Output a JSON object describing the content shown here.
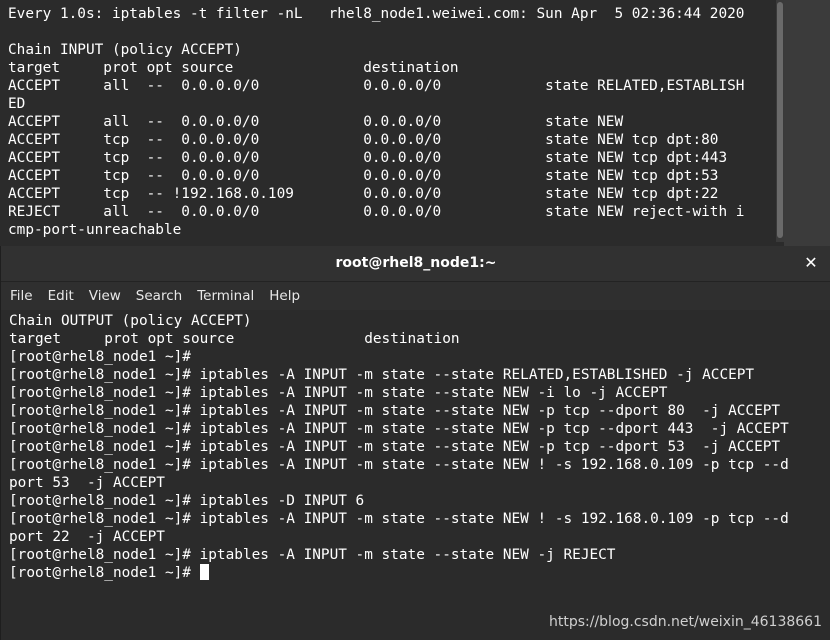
{
  "top_terminal": {
    "lines": [
      "Every 1.0s: iptables -t filter -nL   rhel8_node1.weiwei.com: Sun Apr  5 02:36:44 2020",
      "",
      "Chain INPUT (policy ACCEPT)",
      "target     prot opt source               destination",
      "ACCEPT     all  --  0.0.0.0/0            0.0.0.0/0            state RELATED,ESTABLISH",
      "ED",
      "ACCEPT     all  --  0.0.0.0/0            0.0.0.0/0            state NEW",
      "ACCEPT     tcp  --  0.0.0.0/0            0.0.0.0/0            state NEW tcp dpt:80",
      "ACCEPT     tcp  --  0.0.0.0/0            0.0.0.0/0            state NEW tcp dpt:443",
      "ACCEPT     tcp  --  0.0.0.0/0            0.0.0.0/0            state NEW tcp dpt:53",
      "ACCEPT     tcp  -- !192.168.0.109        0.0.0.0/0            state NEW tcp dpt:22",
      "REJECT     all  --  0.0.0.0/0            0.0.0.0/0            state NEW reject-with i",
      "cmp-port-unreachable"
    ]
  },
  "window": {
    "title": "root@rhel8_node1:~",
    "close_glyph": "✕"
  },
  "menu": {
    "items": [
      "File",
      "Edit",
      "View",
      "Search",
      "Terminal",
      "Help"
    ]
  },
  "bottom_terminal": {
    "lines": [
      "Chain OUTPUT (policy ACCEPT)",
      "target     prot opt source               destination",
      "[root@rhel8_node1 ~]#",
      "[root@rhel8_node1 ~]# iptables -A INPUT -m state --state RELATED,ESTABLISHED -j ACCEPT",
      "[root@rhel8_node1 ~]# iptables -A INPUT -m state --state NEW -i lo -j ACCEPT",
      "[root@rhel8_node1 ~]# iptables -A INPUT -m state --state NEW -p tcp --dport 80  -j ACCEPT",
      "[root@rhel8_node1 ~]# iptables -A INPUT -m state --state NEW -p tcp --dport 443  -j ACCEPT",
      "[root@rhel8_node1 ~]# iptables -A INPUT -m state --state NEW -p tcp --dport 53  -j ACCEPT",
      "[root@rhel8_node1 ~]# iptables -A INPUT -m state --state NEW ! -s 192.168.0.109 -p tcp --d",
      "port 53  -j ACCEPT",
      "[root@rhel8_node1 ~]# iptables -D INPUT 6",
      "[root@rhel8_node1 ~]# iptables -A INPUT -m state --state NEW ! -s 192.168.0.109 -p tcp --d",
      "port 22  -j ACCEPT",
      "[root@rhel8_node1 ~]# iptables -A INPUT -m state --state NEW -j REJECT"
    ],
    "prompt": "[root@rhel8_node1 ~]# "
  },
  "watermark": "https://blog.csdn.net/weixin_46138661"
}
